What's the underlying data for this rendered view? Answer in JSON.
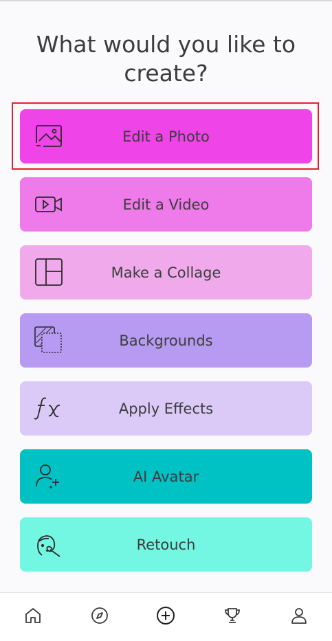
{
  "heading": "What would you like to create?",
  "options": [
    {
      "label": "Edit a Photo",
      "icon": "image-icon",
      "color": "#ee44e8"
    },
    {
      "label": "Edit a Video",
      "icon": "video-camera-icon",
      "color": "#ef7ae9"
    },
    {
      "label": "Make a Collage",
      "icon": "collage-layout-icon",
      "color": "#f0aaec"
    },
    {
      "label": "Backgrounds",
      "icon": "layers-icon",
      "color": "#b79af1"
    },
    {
      "label": "Apply Effects",
      "icon": "fx-icon",
      "color": "#dbc9f8"
    },
    {
      "label": "AI Avatar",
      "icon": "user-sparkle-icon",
      "color": "#00c2c4"
    },
    {
      "label": "Retouch",
      "icon": "face-brush-icon",
      "color": "#73f7e3"
    }
  ],
  "bottom_nav": [
    {
      "icon": "home-icon"
    },
    {
      "icon": "compass-icon"
    },
    {
      "icon": "plus-circle-icon"
    },
    {
      "icon": "trophy-icon"
    },
    {
      "icon": "profile-icon"
    }
  ],
  "colors": {
    "highlight_border": "#e0202e",
    "text": "#3d3d3d",
    "background": "#fafafc"
  }
}
